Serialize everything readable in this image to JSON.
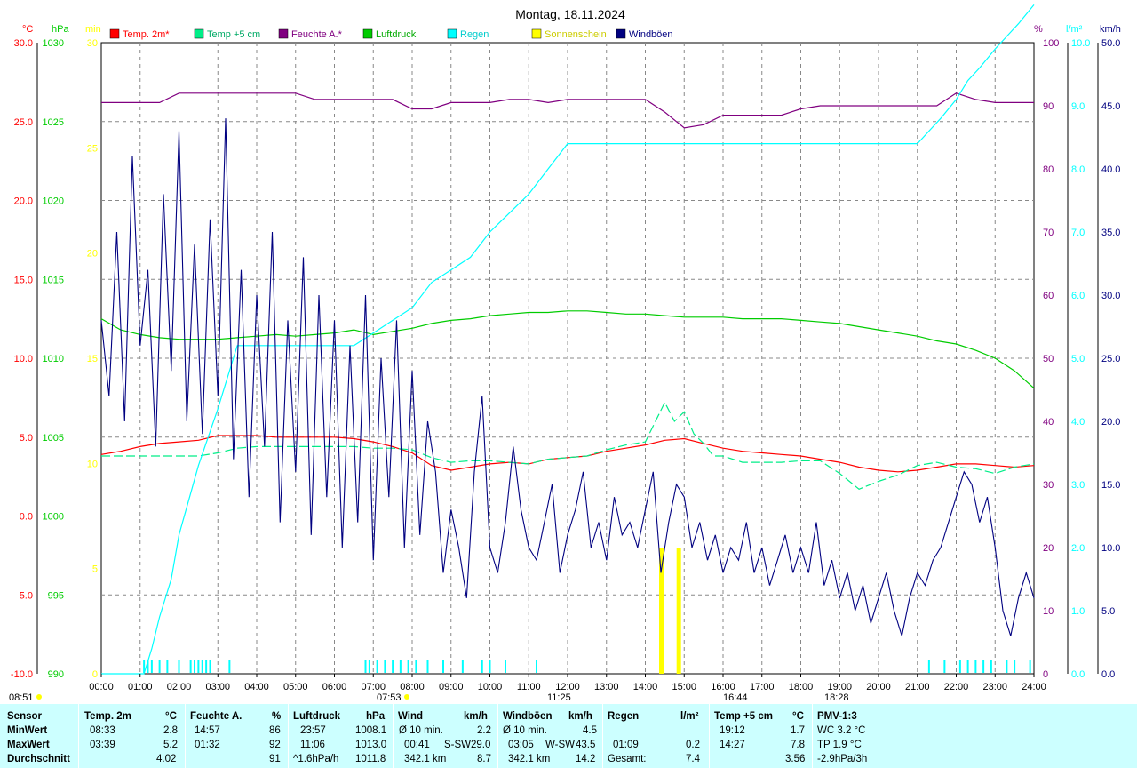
{
  "chart_data": {
    "type": "line",
    "title": "Montag, 18.11.2024",
    "axes": {
      "left": [
        {
          "unit": "°C",
          "color": "#ff0000",
          "range": [
            -10,
            30
          ],
          "ticks": [
            "30.0",
            "25.0",
            "20.0",
            "15.0",
            "10.0",
            "5.0",
            "0.0",
            "-5.0",
            "-10.0"
          ]
        },
        {
          "unit": "hPa",
          "color": "#00cc00",
          "range": [
            990,
            1030
          ],
          "ticks": [
            "1030",
            "1025",
            "1020",
            "1015",
            "1010",
            "1005",
            "1000",
            "995",
            "990"
          ]
        },
        {
          "unit": "min",
          "color": "#ffff00",
          "range": [
            0,
            30
          ],
          "ticks": [
            "30",
            "25",
            "20",
            "15",
            "10",
            "5",
            "0"
          ]
        }
      ],
      "right": [
        {
          "unit": "%",
          "color": "#800080",
          "range": [
            0,
            100
          ],
          "ticks": [
            "100",
            "90",
            "80",
            "70",
            "60",
            "50",
            "40",
            "30",
            "20",
            "10",
            "0"
          ]
        },
        {
          "unit": "l/m²",
          "color": "#00ffff",
          "range": [
            0,
            10
          ],
          "ticks": [
            "10.0",
            "9.0",
            "8.0",
            "7.0",
            "6.0",
            "5.0",
            "4.0",
            "3.0",
            "2.0",
            "1.0",
            "0.0"
          ]
        },
        {
          "unit": "km/h",
          "color": "#000080",
          "range": [
            0,
            50
          ],
          "ticks": [
            "50.0",
            "45.0",
            "40.0",
            "35.0",
            "30.0",
            "25.0",
            "20.0",
            "15.0",
            "10.0",
            "5.0",
            "0.0"
          ]
        }
      ],
      "x_ticks": [
        "00:00",
        "01:00",
        "02:00",
        "03:00",
        "04:00",
        "05:00",
        "06:00",
        "07:00",
        "08:00",
        "09:00",
        "10:00",
        "11:00",
        "12:00",
        "13:00",
        "14:00",
        "15:00",
        "16:00",
        "17:00",
        "18:00",
        "19:00",
        "20:00",
        "21:00",
        "22:00",
        "23:00",
        "24:00"
      ]
    },
    "legend": [
      "Temp. 2m*",
      "Temp +5 cm",
      "Feuchte A.*",
      "Luftdruck",
      "Regen",
      "Sonnenschein",
      "Windböen"
    ],
    "colors": {
      "temp2m": "#ff0000",
      "temp5cm": "#00ee88",
      "feuchte": "#800080",
      "luftdruck": "#00cc00",
      "regen": "#00ffff",
      "sonne": "#ffff00",
      "boeen": "#000080"
    },
    "grid": true,
    "sun_events": {
      "sunrise": "07:53",
      "noon": "11:25",
      "sunset": "16:44",
      "moon": "18:28",
      "prev": "08:51"
    },
    "series": [
      {
        "name": "Temp. 2m*",
        "axis": "°C",
        "x": [
          0,
          0.5,
          1,
          1.5,
          2,
          2.5,
          3,
          3.5,
          4,
          4.5,
          5,
          5.5,
          6,
          6.5,
          7,
          7.5,
          8,
          8.5,
          9,
          9.5,
          10,
          10.5,
          11,
          11.5,
          12,
          12.5,
          13,
          13.5,
          14,
          14.5,
          15,
          15.5,
          16,
          16.5,
          17,
          17.5,
          18,
          18.5,
          19,
          19.5,
          20,
          20.5,
          21,
          21.5,
          22,
          22.5,
          23,
          23.5,
          24
        ],
        "y": [
          3.9,
          4.1,
          4.4,
          4.6,
          4.7,
          4.8,
          5.1,
          5.1,
          5.1,
          5.0,
          5.0,
          5.0,
          5.0,
          4.9,
          4.7,
          4.4,
          4.0,
          3.2,
          2.9,
          3.1,
          3.3,
          3.4,
          3.3,
          3.6,
          3.7,
          3.8,
          4.1,
          4.3,
          4.5,
          4.8,
          4.9,
          4.6,
          4.3,
          4.1,
          4.0,
          3.9,
          3.8,
          3.6,
          3.4,
          3.1,
          2.9,
          2.8,
          2.9,
          3.1,
          3.3,
          3.3,
          3.2,
          3.1,
          3.2
        ]
      },
      {
        "name": "Temp +5 cm",
        "axis": "°C",
        "x": [
          0,
          0.5,
          1,
          1.5,
          2,
          2.5,
          3,
          3.5,
          4,
          4.5,
          5,
          5.5,
          6,
          6.5,
          7,
          7.5,
          8,
          8.5,
          9,
          9.5,
          10,
          10.5,
          11,
          11.5,
          12,
          12.5,
          13,
          13.5,
          14,
          14.5,
          14.75,
          15,
          15.25,
          15.5,
          15.75,
          16,
          16.5,
          17,
          17.5,
          18,
          18.5,
          19,
          19.5,
          20,
          20.5,
          21,
          21.5,
          22,
          22.5,
          23,
          23.5,
          24
        ],
        "y": [
          3.8,
          3.8,
          3.8,
          3.8,
          3.8,
          3.8,
          4.0,
          4.3,
          4.4,
          4.4,
          4.4,
          4.4,
          4.4,
          4.4,
          4.3,
          4.3,
          4.2,
          3.7,
          3.4,
          3.5,
          3.5,
          3.4,
          3.3,
          3.6,
          3.7,
          3.8,
          4.2,
          4.5,
          4.7,
          7.2,
          6.0,
          6.6,
          5.2,
          4.6,
          3.8,
          3.8,
          3.4,
          3.4,
          3.4,
          3.5,
          3.5,
          2.7,
          1.7,
          2.2,
          2.6,
          3.2,
          3.4,
          3.1,
          3.0,
          2.7,
          3.1,
          3.3
        ]
      },
      {
        "name": "Feuchte A.*",
        "axis": "%",
        "x": [
          0,
          0.5,
          1,
          1.5,
          2,
          2.5,
          3,
          3.5,
          4,
          4.5,
          5,
          5.5,
          6,
          6.5,
          7,
          7.5,
          8,
          8.5,
          9,
          9.5,
          10,
          10.5,
          11,
          11.5,
          12,
          12.5,
          13,
          13.5,
          14,
          14.5,
          15,
          15.5,
          16,
          16.5,
          17,
          17.5,
          18,
          18.5,
          19,
          19.5,
          20,
          20.5,
          21,
          21.5,
          22,
          22.5,
          23,
          23.5,
          24
        ],
        "y": [
          90.5,
          90.5,
          90.5,
          90.5,
          92,
          92,
          92,
          92,
          92,
          92,
          92,
          91,
          91,
          91,
          91,
          91,
          89.5,
          89.5,
          90.5,
          90.5,
          90.5,
          91,
          91,
          90.5,
          91,
          91,
          91,
          91,
          91,
          89,
          86.5,
          87,
          88.5,
          88.5,
          88.5,
          88.5,
          89.5,
          90,
          90,
          90,
          90,
          90,
          90,
          90,
          92,
          91,
          90.5,
          90.5,
          90.5
        ]
      },
      {
        "name": "Luftdruck",
        "axis": "hPa",
        "x": [
          0,
          0.5,
          1,
          1.5,
          2,
          2.5,
          3,
          3.5,
          4,
          4.5,
          5,
          5.5,
          6,
          6.5,
          7,
          7.5,
          8,
          8.5,
          9,
          9.5,
          10,
          10.5,
          11,
          11.5,
          12,
          12.5,
          13,
          13.5,
          14,
          14.5,
          15,
          15.5,
          16,
          16.5,
          17,
          17.5,
          18,
          18.5,
          19,
          19.5,
          20,
          20.5,
          21,
          21.5,
          22,
          22.5,
          23,
          23.5,
          24
        ],
        "y": [
          1012.5,
          1011.8,
          1011.5,
          1011.3,
          1011.2,
          1011.2,
          1011.2,
          1011.3,
          1011.4,
          1011.5,
          1011.4,
          1011.5,
          1011.6,
          1011.8,
          1011.5,
          1011.7,
          1011.9,
          1012.2,
          1012.4,
          1012.5,
          1012.7,
          1012.8,
          1012.9,
          1012.9,
          1013.0,
          1013.0,
          1012.9,
          1012.8,
          1012.8,
          1012.7,
          1012.6,
          1012.6,
          1012.6,
          1012.5,
          1012.5,
          1012.5,
          1012.4,
          1012.3,
          1012.2,
          1012.0,
          1011.8,
          1011.6,
          1011.4,
          1011.1,
          1010.9,
          1010.5,
          1010.0,
          1009.2,
          1008.1
        ]
      },
      {
        "name": "Regen",
        "axis": "l/m²",
        "x": [
          0,
          1.1,
          1.3,
          1.5,
          1.8,
          2.0,
          2.5,
          3.0,
          3.5,
          4.0,
          6.5,
          7.0,
          7.5,
          8.0,
          8.5,
          9.0,
          9.5,
          10.0,
          10.5,
          11.0,
          11.5,
          12.0,
          13,
          14,
          15,
          16,
          17,
          18,
          19,
          20,
          21,
          21.3,
          21.6,
          22,
          22.3,
          22.6,
          23,
          23.3,
          23.6,
          24
        ],
        "y": [
          0,
          0,
          0.4,
          0.9,
          1.5,
          2.2,
          3.3,
          4.2,
          5.2,
          5.2,
          5.2,
          5.4,
          5.6,
          5.8,
          6.2,
          6.4,
          6.6,
          7.0,
          7.3,
          7.6,
          8.0,
          8.4,
          8.4,
          8.4,
          8.4,
          8.4,
          8.4,
          8.4,
          8.4,
          8.4,
          8.4,
          8.6,
          8.8,
          9.1,
          9.4,
          9.6,
          9.9,
          10.1,
          10.3,
          10.6
        ]
      },
      {
        "name": "Sonnenschein",
        "axis": "min",
        "x": [
          14.4,
          14.85
        ],
        "y": [
          6,
          6
        ]
      },
      {
        "name": "Windböen",
        "axis": "km/h",
        "x": [
          0,
          0.2,
          0.4,
          0.6,
          0.8,
          1.0,
          1.2,
          1.4,
          1.6,
          1.8,
          2.0,
          2.2,
          2.4,
          2.6,
          2.8,
          3.0,
          3.2,
          3.4,
          3.6,
          3.8,
          4.0,
          4.2,
          4.4,
          4.6,
          4.8,
          5.0,
          5.2,
          5.4,
          5.6,
          5.8,
          6.0,
          6.2,
          6.4,
          6.6,
          6.8,
          7.0,
          7.2,
          7.4,
          7.6,
          7.8,
          8.0,
          8.2,
          8.4,
          8.6,
          8.8,
          9.0,
          9.2,
          9.4,
          9.6,
          9.8,
          10.0,
          10.2,
          10.4,
          10.6,
          10.8,
          11.0,
          11.2,
          11.4,
          11.6,
          11.8,
          12.0,
          12.2,
          12.4,
          12.6,
          12.8,
          13.0,
          13.2,
          13.4,
          13.6,
          13.8,
          14.0,
          14.2,
          14.4,
          14.6,
          14.8,
          15.0,
          15.2,
          15.4,
          15.6,
          15.8,
          16.0,
          16.2,
          16.4,
          16.6,
          16.8,
          17.0,
          17.2,
          17.4,
          17.6,
          17.8,
          18.0,
          18.2,
          18.4,
          18.6,
          18.8,
          19.0,
          19.2,
          19.4,
          19.6,
          19.8,
          20.0,
          20.2,
          20.4,
          20.6,
          20.8,
          21.0,
          21.2,
          21.4,
          21.6,
          21.8,
          22.0,
          22.2,
          22.4,
          22.6,
          22.8,
          23.0,
          23.2,
          23.4,
          23.6,
          23.8,
          24.0
        ],
        "y": [
          28,
          22,
          35,
          20,
          41,
          26,
          32,
          18,
          38,
          24,
          43,
          20,
          34,
          19,
          36,
          22,
          44,
          17,
          32,
          14,
          30,
          18,
          35,
          12,
          28,
          16,
          33,
          11,
          30,
          14,
          28,
          10,
          26,
          12,
          30,
          9,
          25,
          14,
          28,
          10,
          24,
          11,
          20,
          16,
          8,
          13,
          10,
          6,
          16,
          22,
          10,
          8,
          12,
          18,
          13,
          10,
          9,
          12,
          15,
          8,
          11,
          13,
          16,
          10,
          12,
          9,
          14,
          11,
          12,
          10,
          13,
          16,
          8,
          12,
          15,
          14,
          10,
          12,
          9,
          11,
          8,
          10,
          9,
          12,
          8,
          10,
          7,
          9,
          11,
          8,
          10,
          8,
          12,
          7,
          9,
          6,
          8,
          5,
          7,
          4,
          6,
          8,
          5,
          3,
          6,
          8,
          7,
          9,
          10,
          12,
          14,
          16,
          15,
          12,
          14,
          10,
          5,
          3,
          6,
          8,
          6
        ]
      }
    ]
  },
  "stats": {
    "headers": {
      "sensor": "Sensor",
      "temp": "Temp. 2m",
      "temp_unit": "°C",
      "feuchte": "Feuchte A.",
      "feuchte_unit": "%",
      "druck": "Luftdruck",
      "druck_unit": "hPa",
      "wind": "Wind",
      "wind_unit": "km/h",
      "boeen": "Windböen",
      "boeen_unit": "km/h",
      "regen": "Regen",
      "regen_unit": "l/m²",
      "temp5": "Temp +5 cm",
      "temp5_unit": "°C",
      "pmv": "PMV-1:3"
    },
    "rows": [
      {
        "label": "MinWert",
        "temp_t": "08:33",
        "temp_v": "2.8",
        "feuchte_t": "14:57",
        "feuchte_v": "86",
        "druck_t": "23:57",
        "druck_v": "1008.1",
        "wind_t": "Ø 10 min.",
        "wind_v": "2.2",
        "boeen_t": "Ø 10 min.",
        "boeen_v": "4.5",
        "regen_t": "",
        "regen_v": "",
        "temp5_t": "19:12",
        "temp5_v": "1.7",
        "pmv": "WC 3.2 °C"
      },
      {
        "label": "MaxWert",
        "temp_t": "03:39",
        "temp_v": "5.2",
        "feuchte_t": "01:32",
        "feuchte_v": "92",
        "druck_t": "11:06",
        "druck_v": "1013.0",
        "wind_t": "00:41",
        "wind_dir": "S-SW",
        "wind_v": "29.0",
        "boeen_t": "03:05",
        "boeen_dir": "W-SW",
        "boeen_v": "43.5",
        "regen_t": "01:09",
        "regen_v": "0.2",
        "temp5_t": "14:27",
        "temp5_v": "7.8",
        "pmv": "TP 1.9 °C"
      },
      {
        "label": "Durchschnitt",
        "temp_t": "",
        "temp_v": "4.02",
        "feuchte_t": "",
        "feuchte_v": "91",
        "druck_t": "^1.6hPa/h",
        "druck_v": "1011.8",
        "wind_t": "342.1 km",
        "wind_v": "8.7",
        "boeen_t": "342.1 km",
        "boeen_v": "14.2",
        "regen_t": "Gesamt:",
        "regen_v": "7.4",
        "temp5_t": "",
        "temp5_v": "3.56",
        "pmv": "-2.9hPa/3h"
      }
    ]
  }
}
